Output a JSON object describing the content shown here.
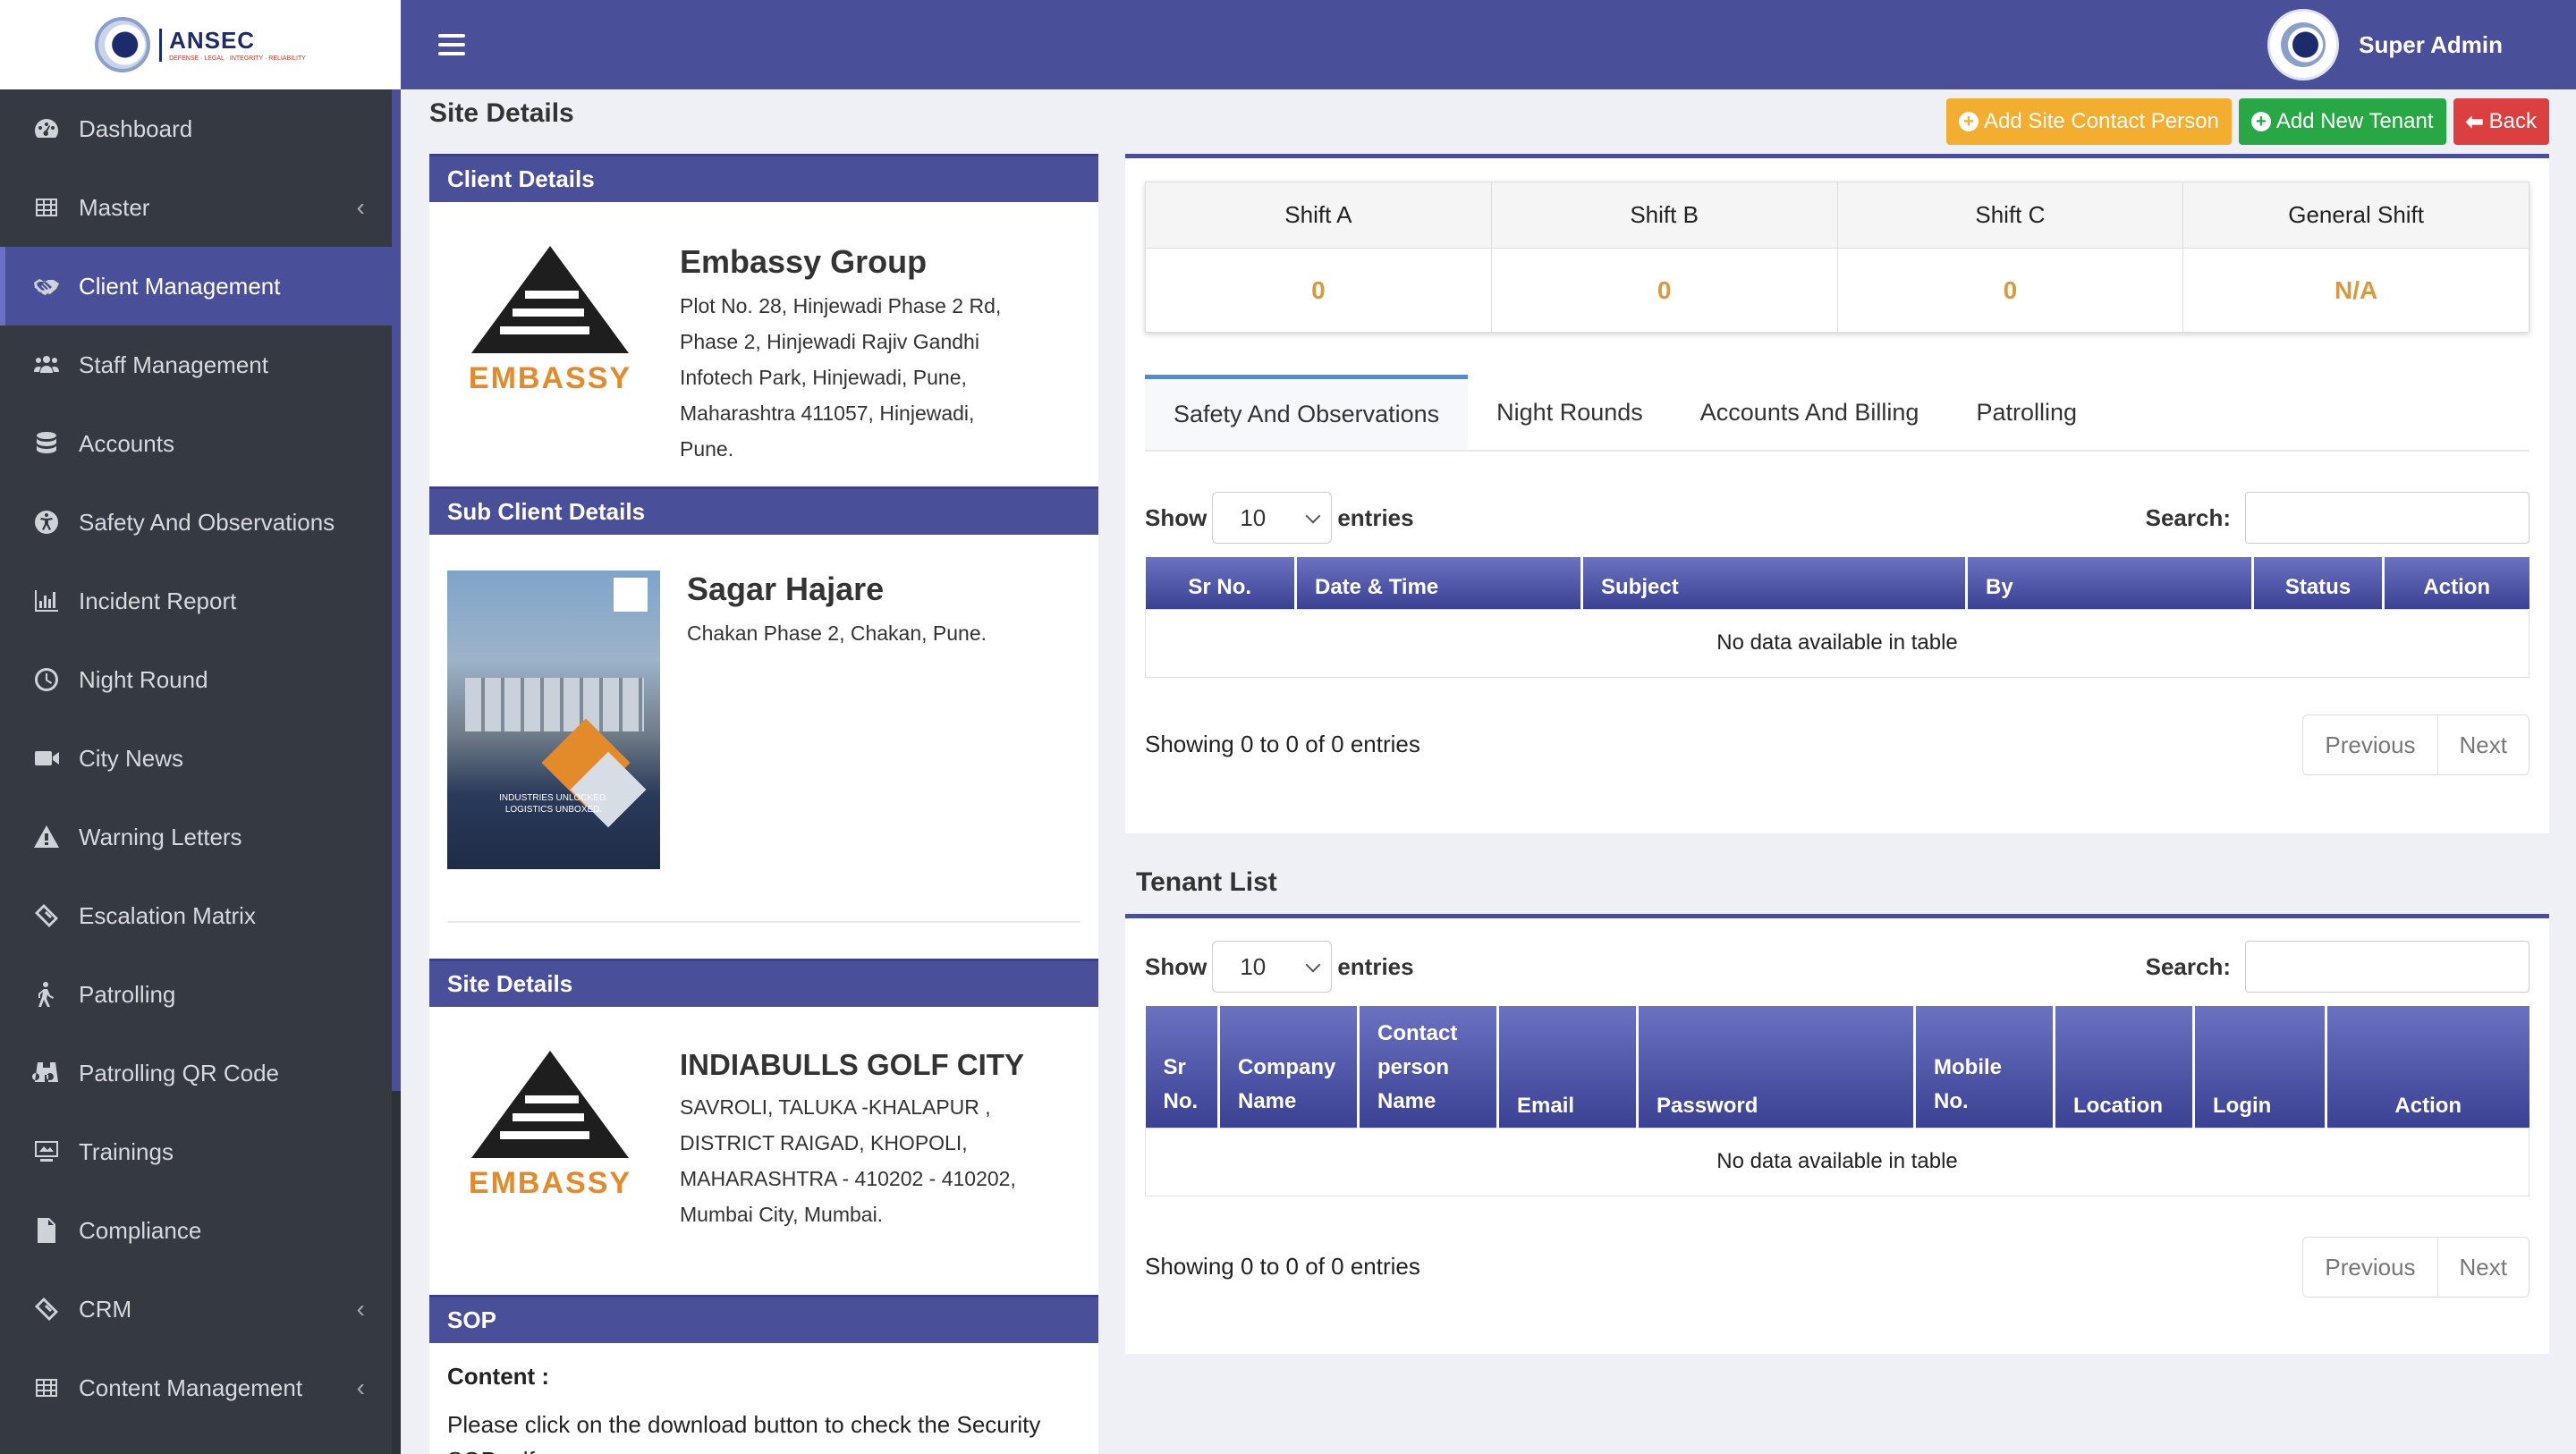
{
  "brand": {
    "name": "ANSEC",
    "tagline": "DEFENSE · LEGAL · INTEGRITY · RELIABILITY"
  },
  "topbar": {
    "user_name": "Super Admin"
  },
  "sidebar": {
    "items": [
      {
        "label": "Dashboard"
      },
      {
        "label": "Master"
      },
      {
        "label": "Client Management"
      },
      {
        "label": "Staff Management"
      },
      {
        "label": "Accounts"
      },
      {
        "label": "Safety And Observations"
      },
      {
        "label": "Incident Report"
      },
      {
        "label": "Night Round"
      },
      {
        "label": "City News"
      },
      {
        "label": "Warning Letters"
      },
      {
        "label": "Escalation Matrix"
      },
      {
        "label": "Patrolling"
      },
      {
        "label": "Patrolling QR Code"
      },
      {
        "label": "Trainings"
      },
      {
        "label": "Compliance"
      },
      {
        "label": "CRM"
      },
      {
        "label": "Content Management"
      }
    ]
  },
  "page": {
    "title": "Site Details",
    "buttons": {
      "add_contact": "Add Site Contact Person",
      "add_tenant": "Add New Tenant",
      "back": "Back"
    }
  },
  "client": {
    "header": "Client Details",
    "name": "Embassy Group",
    "address": "Plot No. 28, Hinjewadi Phase 2 Rd, Phase 2, Hinjewadi Rajiv Gandhi Infotech Park, Hinjewadi, Pune, Maharashtra 411057, Hinjewadi, Pune.",
    "logo_word": "EMBASSY"
  },
  "sub_client": {
    "header": "Sub Client Details",
    "name": "Sagar Hajare",
    "address": "Chakan Phase 2, Chakan, Pune.",
    "thumb_caption_1": "INDUSTRIES UNLOCKED.",
    "thumb_caption_2": "LOGISTICS UNBOXED."
  },
  "site": {
    "header": "Site Details",
    "name": "INDIABULLS GOLF CITY",
    "address": "SAVROLI, TALUKA -KHALAPUR , DISTRICT RAIGAD, KHOPOLI, MAHARASHTRA - 410202 - 410202, Mumbai City, Mumbai.",
    "logo_word": "EMBASSY"
  },
  "sop": {
    "header": "SOP",
    "content_label": "Content :",
    "text": "Please click on the download button to check the Security SOP pdf -"
  },
  "shifts": {
    "headers": [
      "Shift A",
      "Shift B",
      "Shift C",
      "General Shift"
    ],
    "values": [
      "0",
      "0",
      "0",
      "N/A"
    ]
  },
  "tabs": [
    "Safety And Observations",
    "Night Rounds",
    "Accounts And Billing",
    "Patrolling"
  ],
  "observations_table": {
    "show_label": "Show",
    "entries_value": "10",
    "entries_label": "entries",
    "search_label": "Search:",
    "columns": [
      "Sr No.",
      "Date & Time",
      "Subject",
      "By",
      "Status",
      "Action"
    ],
    "empty": "No data available in table",
    "info": "Showing 0 to 0 of 0 entries",
    "prev": "Previous",
    "next": "Next"
  },
  "tenant": {
    "title": "Tenant List",
    "show_label": "Show",
    "entries_value": "10",
    "entries_label": "entries",
    "search_label": "Search:",
    "columns": [
      "Sr No.",
      "Company Name",
      "Contact person Name",
      "Email",
      "Password",
      "Mobile No.",
      "Location",
      "Login",
      "Action"
    ],
    "empty": "No data available in table",
    "info": "Showing 0 to 0 of 0 entries",
    "prev": "Previous",
    "next": "Next"
  },
  "colors": {
    "primary": "#4a4f9a",
    "sidebar": "#343a40",
    "warning": "#f3ad2f",
    "success": "#27a845",
    "danger": "#dc3f3f",
    "shift_value": "#d99a3e"
  }
}
